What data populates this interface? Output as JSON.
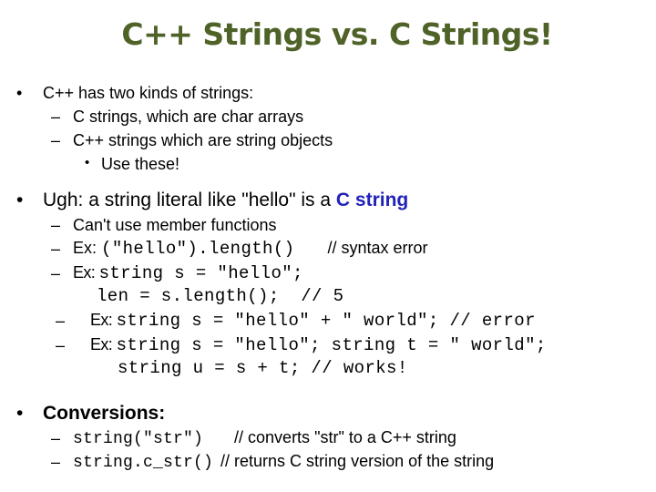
{
  "slide": {
    "title": "C++ Strings vs. C Strings!",
    "colors": {
      "title": "#4f6228",
      "accent": "#2222bb",
      "text": "#000000",
      "background": "#ffffff"
    },
    "bullet_icon": "•",
    "dash_icon": "–",
    "section1": {
      "heading": "C++ has two kinds of strings:",
      "items": [
        "C strings, which are char arrays",
        "C++ strings which are string objects"
      ],
      "subitem": "Use these!"
    },
    "section2": {
      "heading_prefix": "Ugh: a string literal like \"hello\" is a ",
      "heading_highlight": "C string",
      "items": [
        {
          "text": "Can't use member functions"
        },
        {
          "label": "Ex: ",
          "code": "(\"hello\").length()",
          "comment": "// syntax error"
        },
        {
          "label": "Ex: ",
          "code": "string s = \"hello\";",
          "code_cont": "len = s.length();  // 5"
        },
        {
          "label": "Ex: ",
          "code": "string s = \"hello\" + \" world\"; // error"
        },
        {
          "label": "Ex: ",
          "code": "string s = \"hello\"; string t = \" world\";",
          "code_cont": "string u = s + t; // works!"
        }
      ]
    },
    "section3": {
      "heading": "Conversions:",
      "items": [
        {
          "code": "string(\"str\")",
          "comment": "// converts \"str\" to a C++ string"
        },
        {
          "code": "string.c_str()",
          "comment": "// returns C string version of the string"
        }
      ]
    }
  }
}
